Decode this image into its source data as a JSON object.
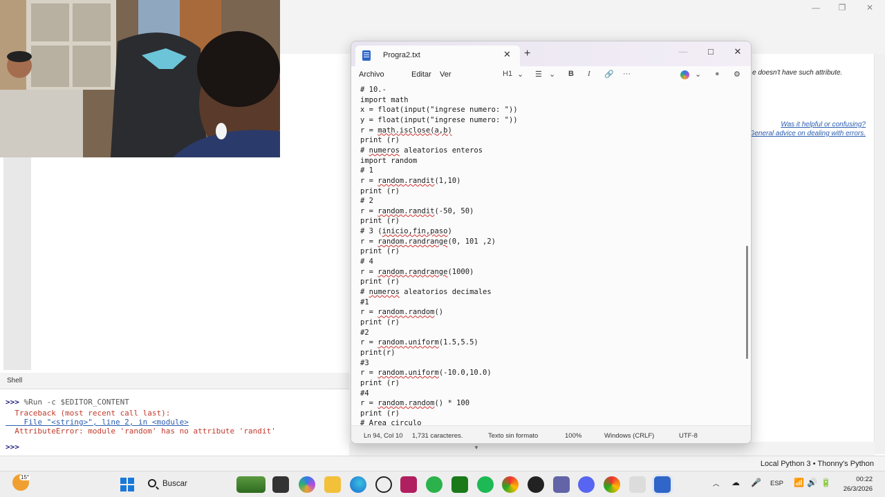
{
  "thonny": {
    "assistant_text": "e doesn't have such attribute.",
    "assistant_link1": "Was it helpful or confusing?",
    "assistant_link2": "General advice on dealing with errors.",
    "shell_tab": "Shell",
    "shell_lines": [
      {
        "prompt": ">>>",
        "text": " %Run -c $EDITOR_CONTENT"
      },
      {
        "text": "  Traceback (most recent call last):"
      },
      {
        "text": "    File \"<string>\", line 2, in <module>"
      },
      {
        "text": "  AttributeError: module 'random' has no attribute 'randit'"
      },
      {
        "prompt": ">>>",
        "text": ""
      }
    ],
    "status_interpreter": "Local Python 3 • Thonny's Python",
    "window_min": "—",
    "window_restore": "❐",
    "window_close": "✕"
  },
  "notepad": {
    "tab_title": "Progra2.txt",
    "tab_close": "✕",
    "add_tab": "+",
    "minimize": "—",
    "maximize": "□",
    "close": "✕",
    "menu": [
      "Archivo",
      "Editar",
      "Ver"
    ],
    "toolbar": {
      "heading": "H1",
      "heading_chevron": "⌄",
      "list_icon": "☰",
      "list_chevron": "⌄",
      "bold": "B",
      "italic": "I",
      "link_icon": "🔗",
      "more": "···",
      "copilot_chevron": "⌄",
      "account_icon": "●",
      "settings_icon": "⚙"
    },
    "code_lines": [
      "# 10.-",
      "import math",
      "x = float(input(\"ingrese numero: \"))",
      "y = float(input(\"ingrese numero: \"))",
      "r = math.isclose(a,b)",
      "print (r)",
      "# numeros aleatorios enteros",
      "import random",
      "# 1",
      "r = random.randit(1,10)",
      "print (r)",
      "# 2",
      "r = random.randit(-50, 50)",
      "print (r)",
      "# 3 (inicio,fin,paso)",
      "r = random.randrange(0, 101 ,2)",
      "print (r)",
      "# 4",
      "r = random.randrange(1000)",
      "print (r)",
      "# numeros aleatorios decimales",
      "#1",
      "r = random.random()",
      "print (r)",
      "#2",
      "r = random.uniform(1.5,5.5)",
      "print(r)",
      "#3",
      "r = random.uniform(-10.0,10.0)",
      "print (r)",
      "#4",
      "r = random.random() * 100",
      "print (r)",
      "# Area circulo"
    ],
    "status": {
      "position": "Ln 94, Col 10",
      "chars": "1,731 caracteres.",
      "format": "Texto sin formato",
      "zoom": "100%",
      "line_ending": "Windows (CRLF)",
      "encoding": "UTF-8"
    }
  },
  "taskbar": {
    "weather_temp": "15°",
    "search_label": "Buscar",
    "language": "ESP",
    "time": "00:22",
    "date": "26/3/2026",
    "pinned_apps": [
      "nature-widget",
      "file-explorer",
      "copilot",
      "folder",
      "edge",
      "chatgpt",
      "onenote",
      "whatsapp",
      "xbox",
      "spotify",
      "chrome",
      "obs",
      "teams",
      "discord",
      "chrome-profile",
      "thonny",
      "notepad"
    ]
  },
  "colors": {
    "accent_blue": "#2f66c8",
    "error_red": "#c0392b",
    "link_blue": "#2a5db0"
  }
}
